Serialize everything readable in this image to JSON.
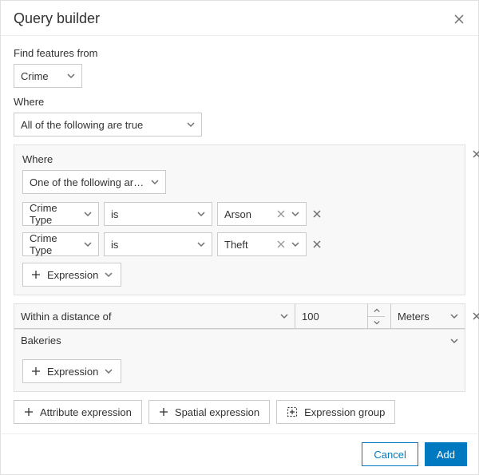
{
  "dialog": {
    "title": "Query builder",
    "find_label": "Find features from",
    "where_label": "Where",
    "layer": "Crime",
    "match": "All of the following are true"
  },
  "group1": {
    "where_label": "Where",
    "match": "One of the following are tr…",
    "rows": [
      {
        "field": "Crime Type",
        "op": "is",
        "value": "Arson"
      },
      {
        "field": "Crime Type",
        "op": "is",
        "value": "Theft"
      }
    ],
    "expression_btn": "Expression"
  },
  "spatial": {
    "relation": "Within a distance of",
    "distance": "100",
    "units": "Meters",
    "layer": "Bakeries",
    "expression_btn": "Expression"
  },
  "add_buttons": {
    "attribute": "Attribute expression",
    "spatial": "Spatial expression",
    "group": "Expression group"
  },
  "footer": {
    "cancel": "Cancel",
    "add": "Add"
  }
}
